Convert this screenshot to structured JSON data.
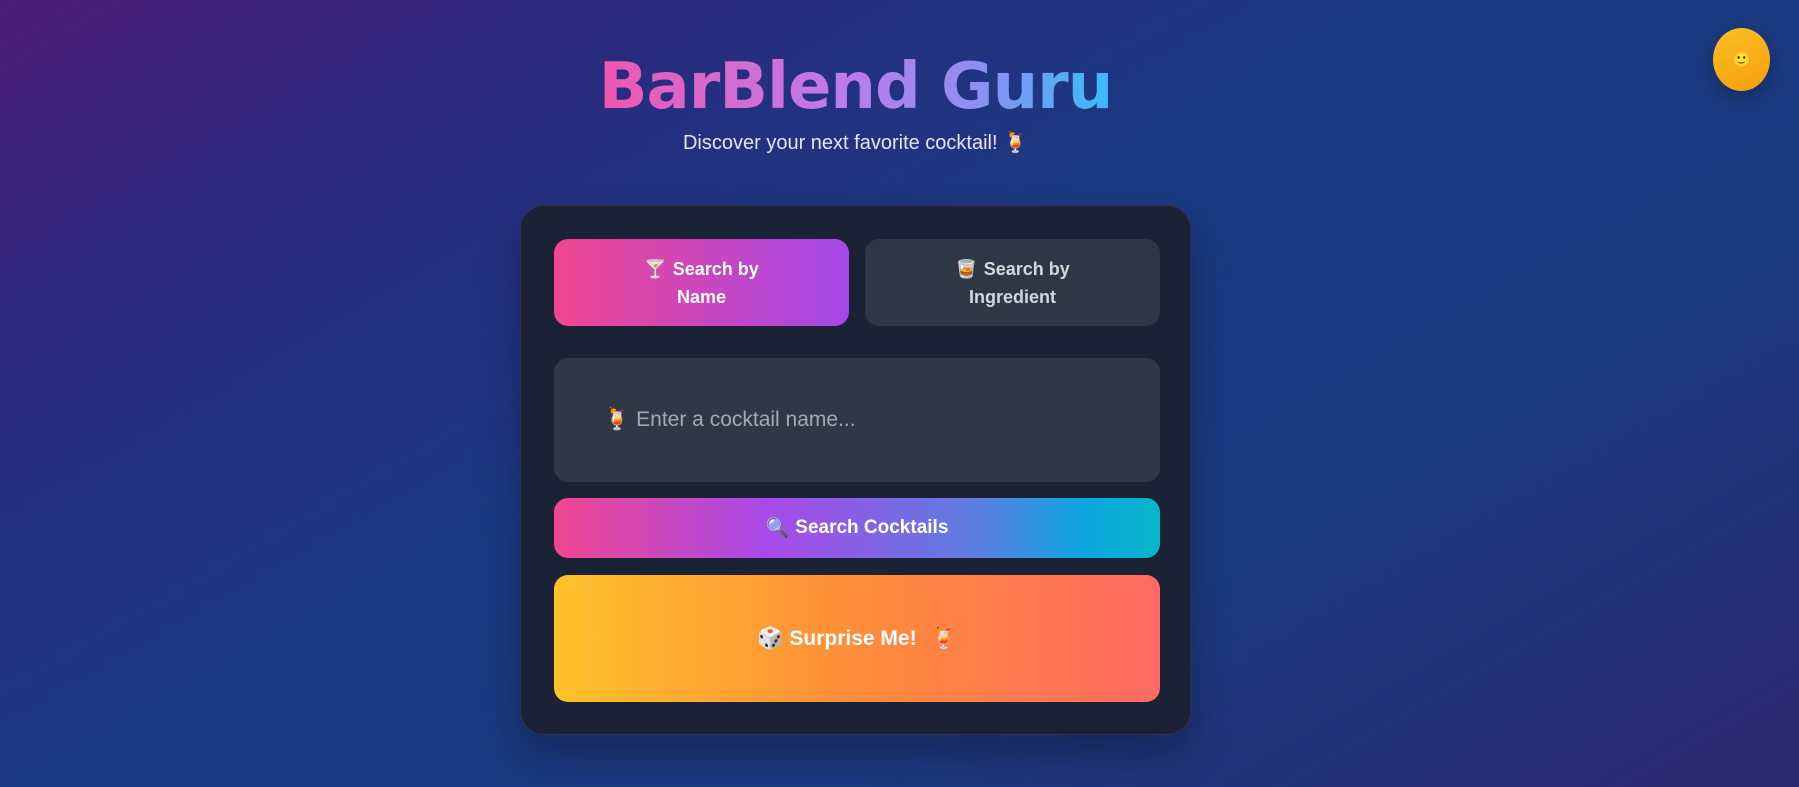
{
  "theme_toggle": {
    "icon": "🙂",
    "icon_name": "sun-face-icon"
  },
  "header": {
    "title": "BarBlend Guru",
    "subtitle": "Discover your next favorite cocktail! 🍹"
  },
  "tabs": [
    {
      "icon": "🍸",
      "icon_name": "cocktail-glass-icon",
      "label": "Search by Name",
      "active": true
    },
    {
      "icon": "🥃",
      "icon_name": "tumbler-glass-icon",
      "label": "Search by Ingredient",
      "active": false
    }
  ],
  "search": {
    "icon": "🍹",
    "icon_name": "tropical-drink-icon",
    "placeholder": "Enter a cocktail name...",
    "value": ""
  },
  "search_button": {
    "icon": "🔍",
    "icon_name": "magnifier-icon",
    "label": "Search Cocktails"
  },
  "surprise_button": {
    "icon": "🎲",
    "icon_name": "dice-icon",
    "label": "Surprise Me!",
    "trail_icon": "🍹"
  },
  "colors": {
    "accent_pink": "#f0468f",
    "accent_purple": "#a448ea",
    "accent_cyan": "#06b6c8",
    "surprise_yellow": "#ffc22b",
    "surprise_red": "#ff6a62",
    "card_bg": "#1b2236"
  }
}
